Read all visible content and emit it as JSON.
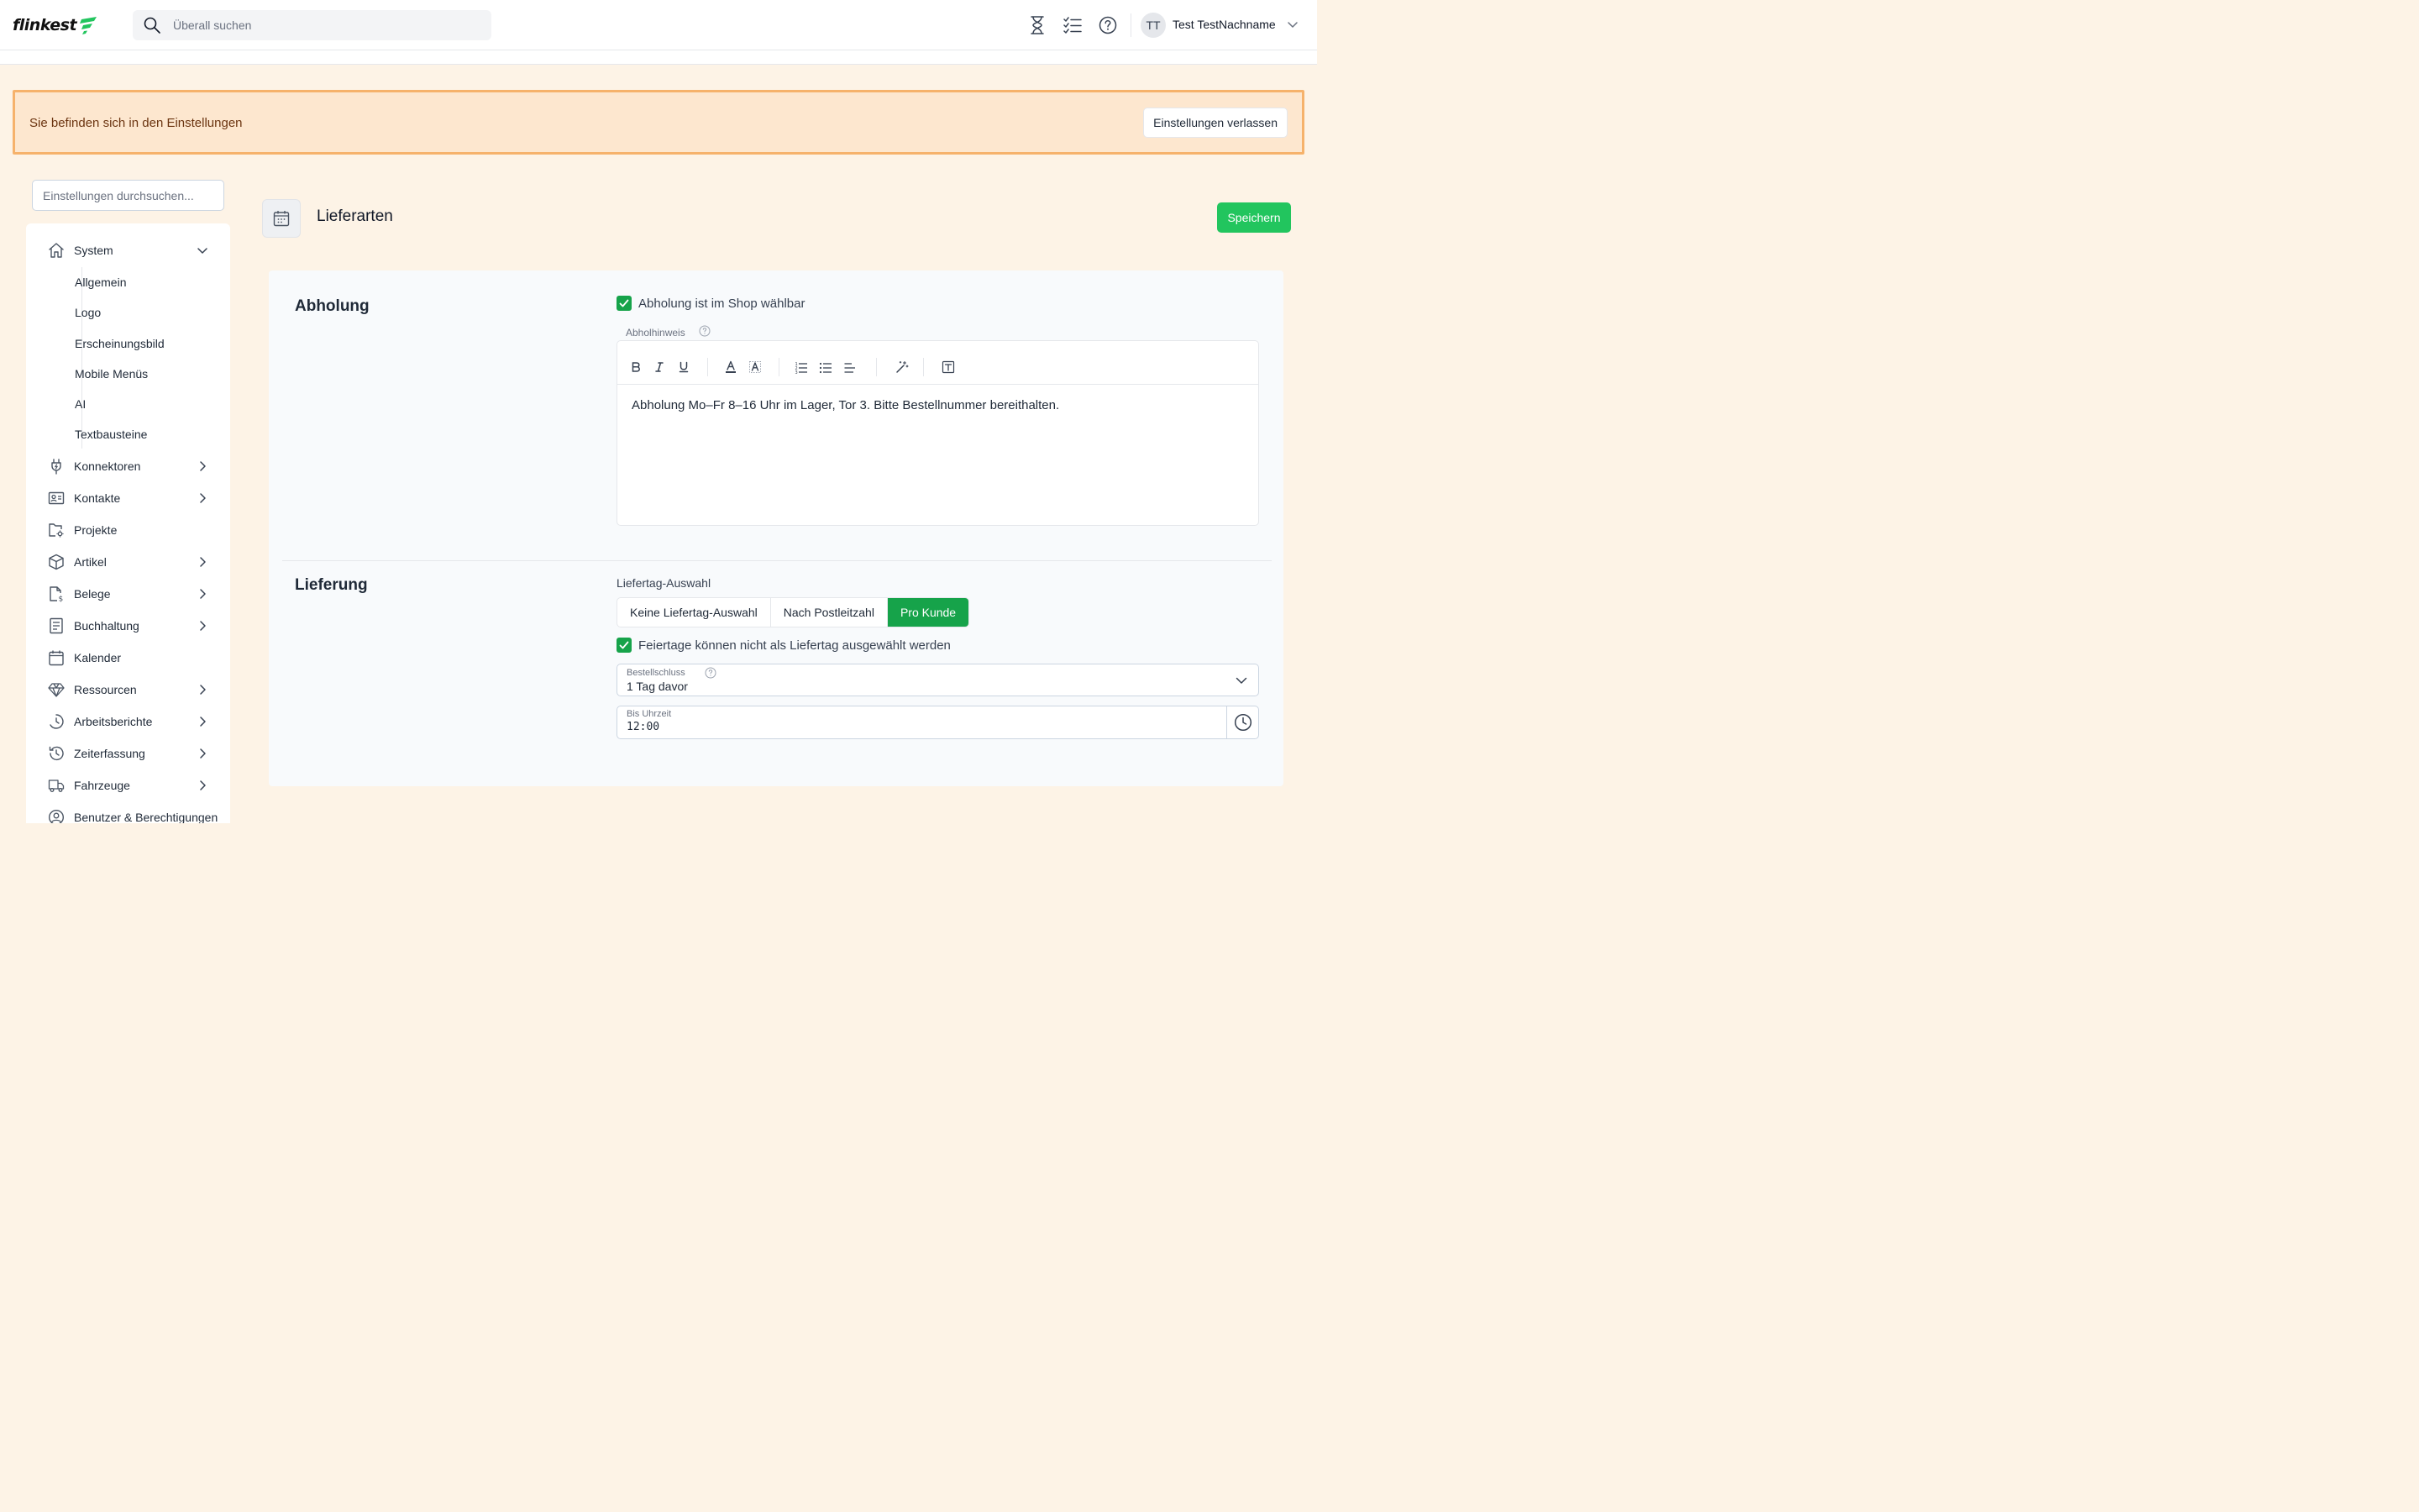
{
  "header": {
    "logo_text": "flinkest",
    "search_placeholder": "Überall suchen",
    "user_initials": "TT",
    "user_name": "Test TestNachname"
  },
  "banner": {
    "text": "Sie befinden sich in den Einstellungen",
    "exit_label": "Einstellungen verlassen"
  },
  "sidebar": {
    "search_placeholder": "Einstellungen durchsuchen...",
    "system_label": "System",
    "subitems": [
      "Allgemein",
      "Logo",
      "Erscheinungsbild",
      "Mobile Menüs",
      "AI",
      "Textbausteine"
    ],
    "items": [
      {
        "label": "Konnektoren",
        "icon": "plug-icon"
      },
      {
        "label": "Kontakte",
        "icon": "contact-card-icon"
      },
      {
        "label": "Projekte",
        "icon": "folder-gear-icon"
      },
      {
        "label": "Artikel",
        "icon": "box-icon"
      },
      {
        "label": "Belege",
        "icon": "document-dollar-icon"
      },
      {
        "label": "Buchhaltung",
        "icon": "ledger-icon"
      },
      {
        "label": "Kalender",
        "icon": "calendar-icon"
      },
      {
        "label": "Ressourcen",
        "icon": "diamond-icon"
      },
      {
        "label": "Arbeitsberichte",
        "icon": "clock-report-icon"
      },
      {
        "label": "Zeiterfassung",
        "icon": "history-icon"
      },
      {
        "label": "Fahrzeuge",
        "icon": "truck-icon"
      },
      {
        "label": "Benutzer & Berechtigungen",
        "icon": "user-circle-icon"
      }
    ]
  },
  "main": {
    "title": "Lieferarten",
    "save_label": "Speichern",
    "abholung": {
      "title": "Abholung",
      "checkbox_label": "Abholung ist im Shop wählbar",
      "hint_label": "Abholhinweis",
      "hint_text": "Abholung Mo–Fr 8–16 Uhr im Lager, Tor 3. Bitte Bestellnummer bereithalten."
    },
    "lieferung": {
      "title": "Lieferung",
      "selection_label": "Liefertag-Auswahl",
      "options": [
        "Keine Liefertag-Auswahl",
        "Nach Postleitzahl",
        "Pro Kunde"
      ],
      "selected_option": "Pro Kunde",
      "holiday_label": "Feiertage können nicht als Liefertag ausgewählt werden",
      "cutoff_caption": "Bestellschluss",
      "cutoff_value": "1 Tag davor",
      "time_caption": "Bis Uhrzeit",
      "time_value": "12:00"
    }
  },
  "colors": {
    "accent": "#16a34a",
    "save": "#22c55e",
    "banner_bg": "#fde7cf",
    "banner_border": "#f6b26b",
    "page_bg": "#fdf3e6"
  }
}
